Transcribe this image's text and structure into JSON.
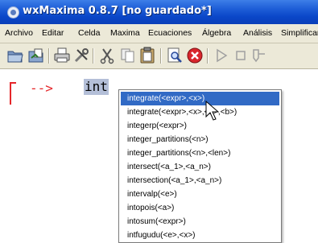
{
  "window": {
    "title": "wxMaxima 0.8.7 [no guardado*]"
  },
  "menubar": {
    "items": [
      "Archivo",
      "Editar",
      "Celda",
      "Maxima",
      "Ecuaciones",
      "Álgebra",
      "Análisis",
      "Simplificar"
    ]
  },
  "toolbar": {
    "icons": [
      "open-icon",
      "save-as-icon",
      "print-icon",
      "settings-icon",
      "cut-icon",
      "copy-icon",
      "paste-icon",
      "find-icon",
      "stop-icon",
      "play-icon",
      "stop-square-icon",
      "step-icon"
    ]
  },
  "worksheet": {
    "prompt": "-->",
    "input": "int"
  },
  "autocomplete": {
    "items": [
      "integrate(<expr>,<x>)",
      "integrate(<expr>,<x>,<a>,<b>)",
      "integerp(<expr>)",
      "integer_partitions(<n>)",
      "integer_partitions(<n>,<len>)",
      "intersect(<a_1>,<a_n>)",
      "intersection(<a_1>,<a_n>)",
      "intervalp(<e>)",
      "intopois(<a>)",
      "intosum(<expr>)",
      "intfugudu(<e>,<x>)"
    ],
    "selected_index": 0
  },
  "colors": {
    "titlebar": "#0a46c8",
    "menubar": "#ece9d8",
    "prompt": "#e5262a",
    "input_highlight": "#b4bfd8",
    "selection": "#316ac5"
  }
}
